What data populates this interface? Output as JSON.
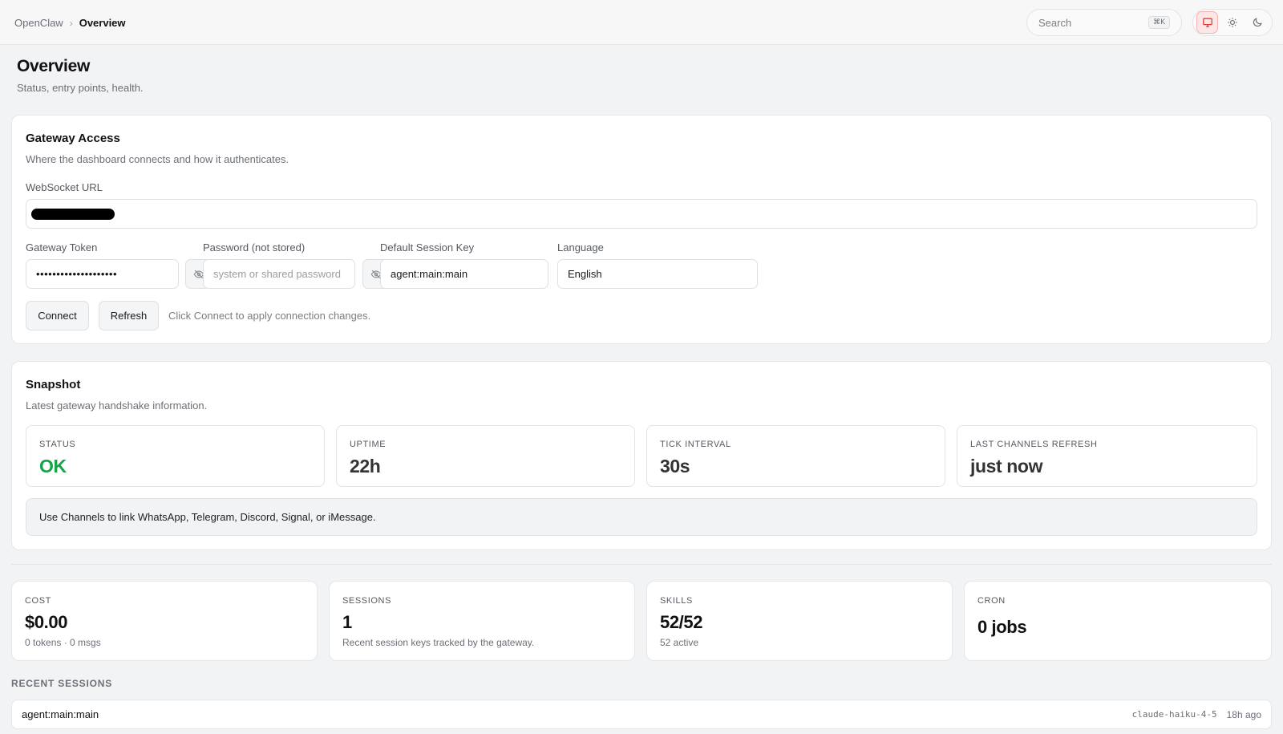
{
  "topbar": {
    "breadcrumb_root": "OpenClaw",
    "breadcrumb_sep": "›",
    "breadcrumb_current": "Overview",
    "search_placeholder": "Search",
    "search_shortcut": "⌘K",
    "theme_modes": [
      "system-icon",
      "sun-icon",
      "moon-icon"
    ],
    "active_theme": "system"
  },
  "header": {
    "title": "Overview",
    "subtitle": "Status, entry points, health."
  },
  "gateway": {
    "title": "Gateway Access",
    "subtitle": "Where the dashboard connects and how it authenticates.",
    "ws_label": "WebSocket URL",
    "token_label": "Gateway Token",
    "token_value": "••••••••••••••••••••",
    "password_label": "Password (not stored)",
    "password_placeholder": "system or shared password",
    "session_key_label": "Default Session Key",
    "session_key_value": "agent:main:main",
    "language_label": "Language",
    "language_value": "English",
    "connect_label": "Connect",
    "refresh_label": "Refresh",
    "hint": "Click Connect to apply connection changes."
  },
  "snapshot": {
    "title": "Snapshot",
    "subtitle": "Latest gateway handshake information.",
    "stats": [
      {
        "label": "STATUS",
        "value": "OK"
      },
      {
        "label": "UPTIME",
        "value": "22h"
      },
      {
        "label": "TICK INTERVAL",
        "value": "30s"
      },
      {
        "label": "LAST CHANNELS REFRESH",
        "value": "just now"
      }
    ],
    "callout": "Use Channels to link WhatsApp, Telegram, Discord, Signal, or iMessage."
  },
  "metrics": [
    {
      "label": "COST",
      "value": "$0.00",
      "sub": "0 tokens · 0 msgs"
    },
    {
      "label": "SESSIONS",
      "value": "1",
      "sub": "Recent session keys tracked by the gateway."
    },
    {
      "label": "SKILLS",
      "value": "52/52",
      "sub": "52 active"
    },
    {
      "label": "CRON",
      "value": "0 jobs",
      "sub": ""
    }
  ],
  "recent_sessions": {
    "heading": "RECENT SESSIONS",
    "rows": [
      {
        "key": "agent:main:main",
        "model": "claude-haiku-4-5",
        "age": "18h ago"
      }
    ]
  },
  "colors": {
    "status_ok": "#16a34a",
    "accent_active": "#e23b3b",
    "background": "#f2f3f5"
  }
}
